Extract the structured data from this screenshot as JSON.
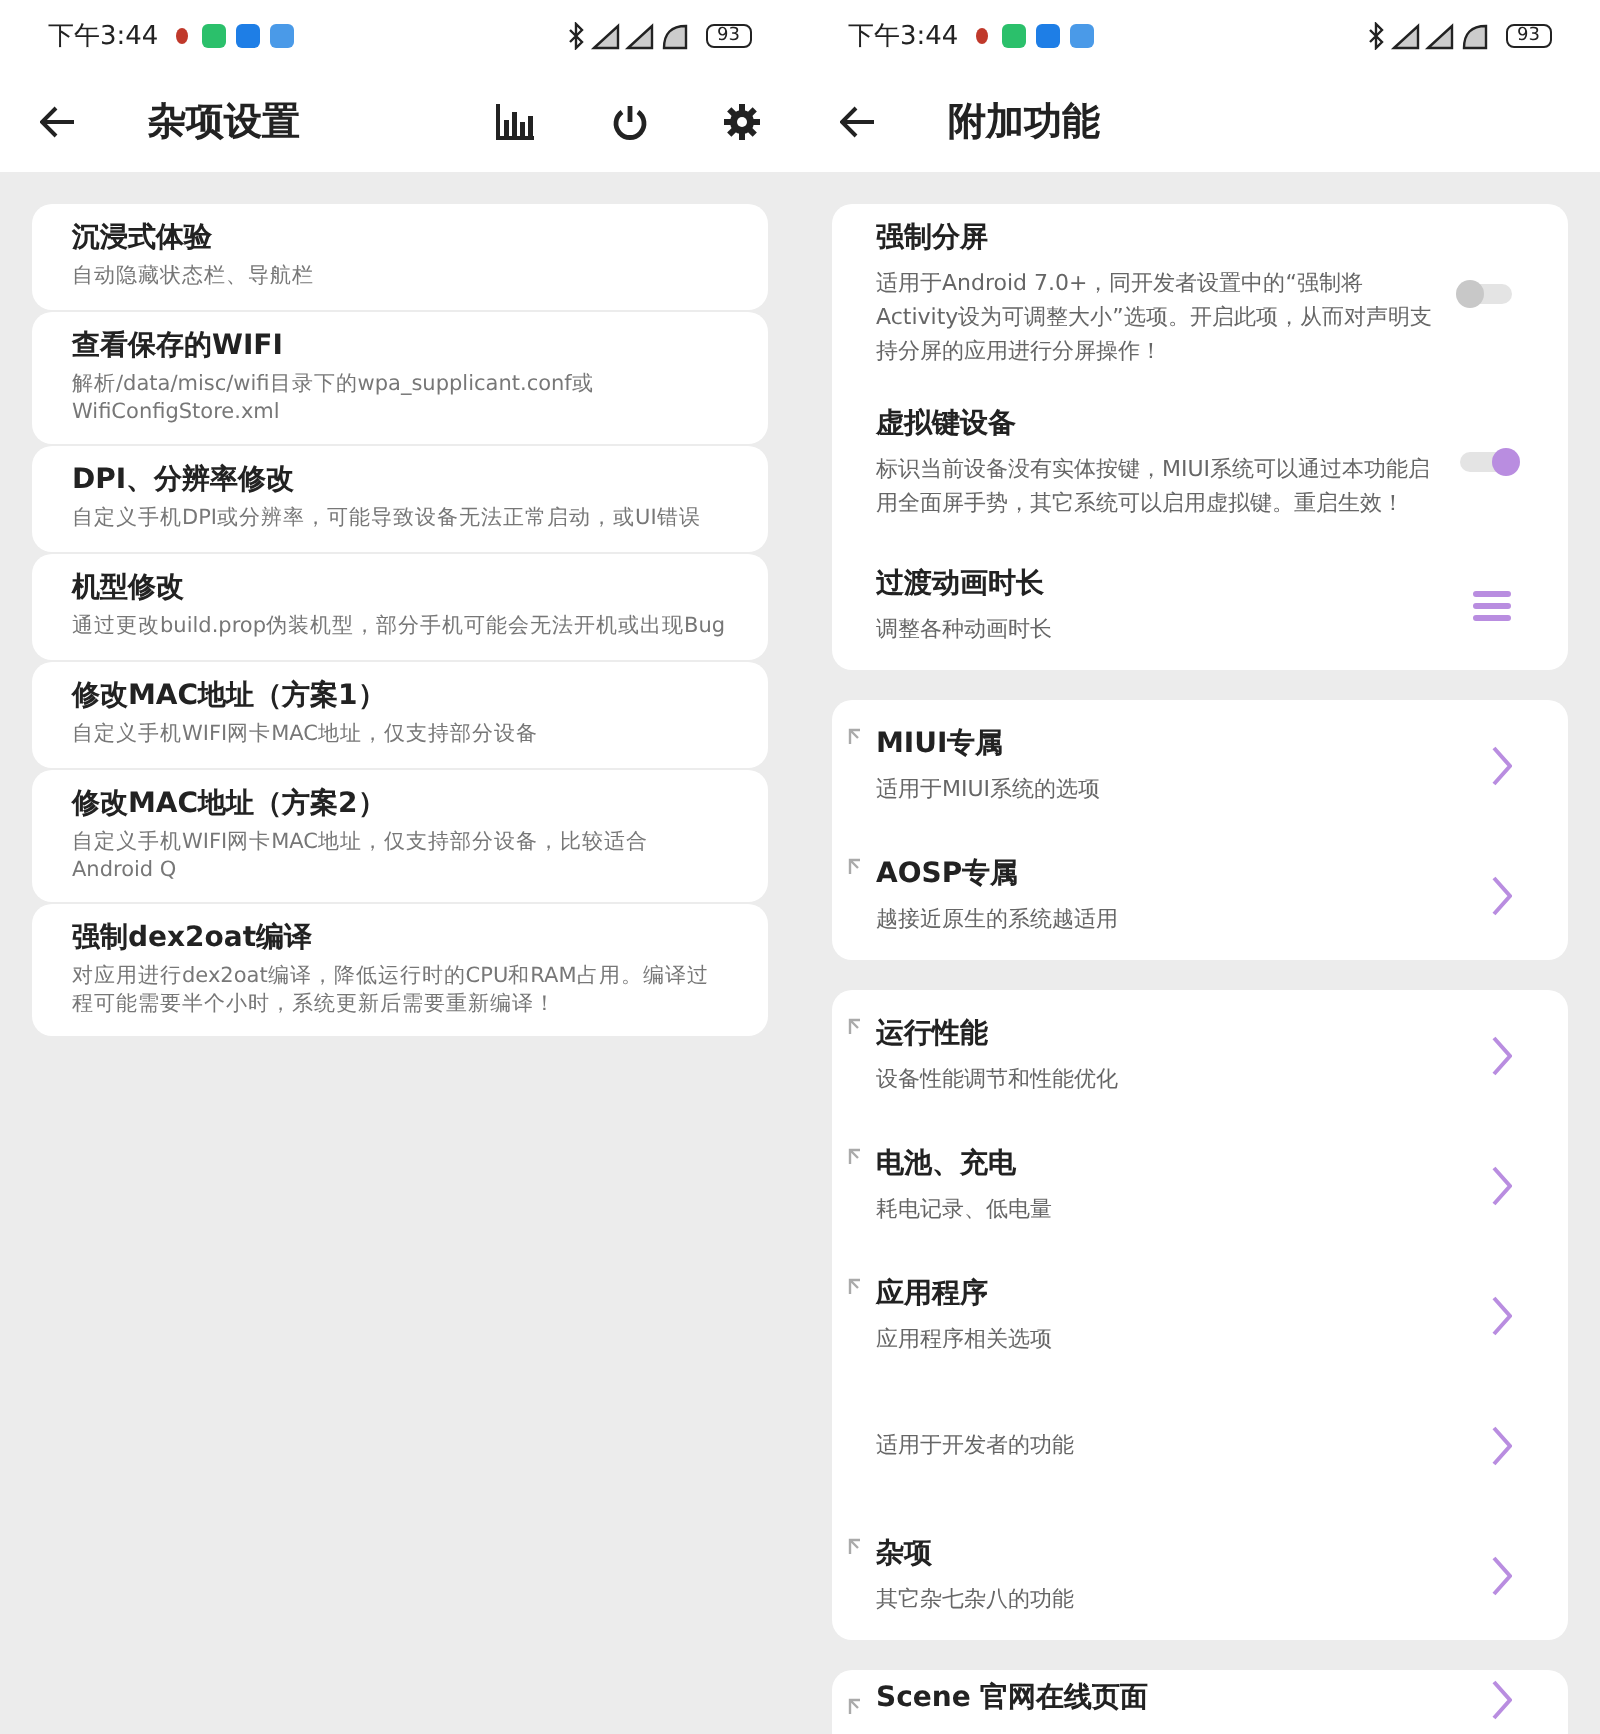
{
  "left_screen": {
    "status_bar": {
      "time": "下午3:44",
      "battery": "93"
    },
    "title": "杂项设置",
    "items": [
      {
        "title": "沉浸式体验",
        "description": "自动隐藏状态栏、导航栏"
      },
      {
        "title": "查看保存的WIFI",
        "description": "解析/data/misc/wifi目录下的wpa_supplicant.conf或WifiConfigStore.xml"
      },
      {
        "title": "DPI、分辨率修改",
        "description": "自定义手机DPI或分辨率，可能导致设备无法正常启动，或UI错误"
      },
      {
        "title": "机型修改",
        "description": "通过更改build.prop伪装机型，部分手机可能会无法开机或出现Bug"
      },
      {
        "title": "修改MAC地址（方案1）",
        "description": "自定义手机WIFI网卡MAC地址，仅支持部分设备"
      },
      {
        "title": "修改MAC地址（方案2）",
        "description": "自定义手机WIFI网卡MAC地址，仅支持部分设备，比较适合Android Q"
      },
      {
        "title": "强制dex2oat编译",
        "description": "对应用进行dex2oat编译，降低运行时的CPU和RAM占用。编译过程可能需要半个小时，系统更新后需要重新编译！"
      }
    ]
  },
  "right_screen": {
    "status_bar": {
      "time": "下午3:44",
      "battery": "93"
    },
    "title": "附加功能",
    "groups": [
      {
        "items": [
          {
            "kind": "toggle",
            "title": "强制分屏",
            "description": "适用于Android 7.0+，同开发者设置中的“强制将Activity设为可调整大小”选项。开启此项，从而对声明支持分屏的应用进行分屏操作！",
            "on": false
          },
          {
            "kind": "toggle",
            "title": "虚拟键设备",
            "description": "标识当前设备没有实体按键，MIUI系统可以通过本功能启用全面屏手势，其它系统可以启用虚拟键。重启生效！",
            "on": true
          },
          {
            "kind": "menu",
            "title": "过渡动画时长",
            "description": "调整各种动画时长"
          }
        ]
      },
      {
        "items": [
          {
            "kind": "link",
            "title": "MIUI专属",
            "description": "适用于MIUI系统的选项"
          },
          {
            "kind": "link",
            "title": "AOSP专属",
            "description": "越接近原生的系统越适用"
          }
        ]
      },
      {
        "items": [
          {
            "kind": "link",
            "title": "运行性能",
            "description": "设备性能调节和性能优化"
          },
          {
            "kind": "link",
            "title": "电池、充电",
            "description": "耗电记录、低电量"
          },
          {
            "kind": "link",
            "title": "应用程序",
            "description": "应用程序相关选项"
          },
          {
            "kind": "link",
            "description": "适用于开发者的功能"
          },
          {
            "kind": "link",
            "title": "杂项",
            "description": "其它杂七杂八的功能"
          }
        ]
      },
      {
        "items": [
          {
            "kind": "link",
            "title": "Scene 官网在线页面"
          }
        ]
      }
    ]
  }
}
